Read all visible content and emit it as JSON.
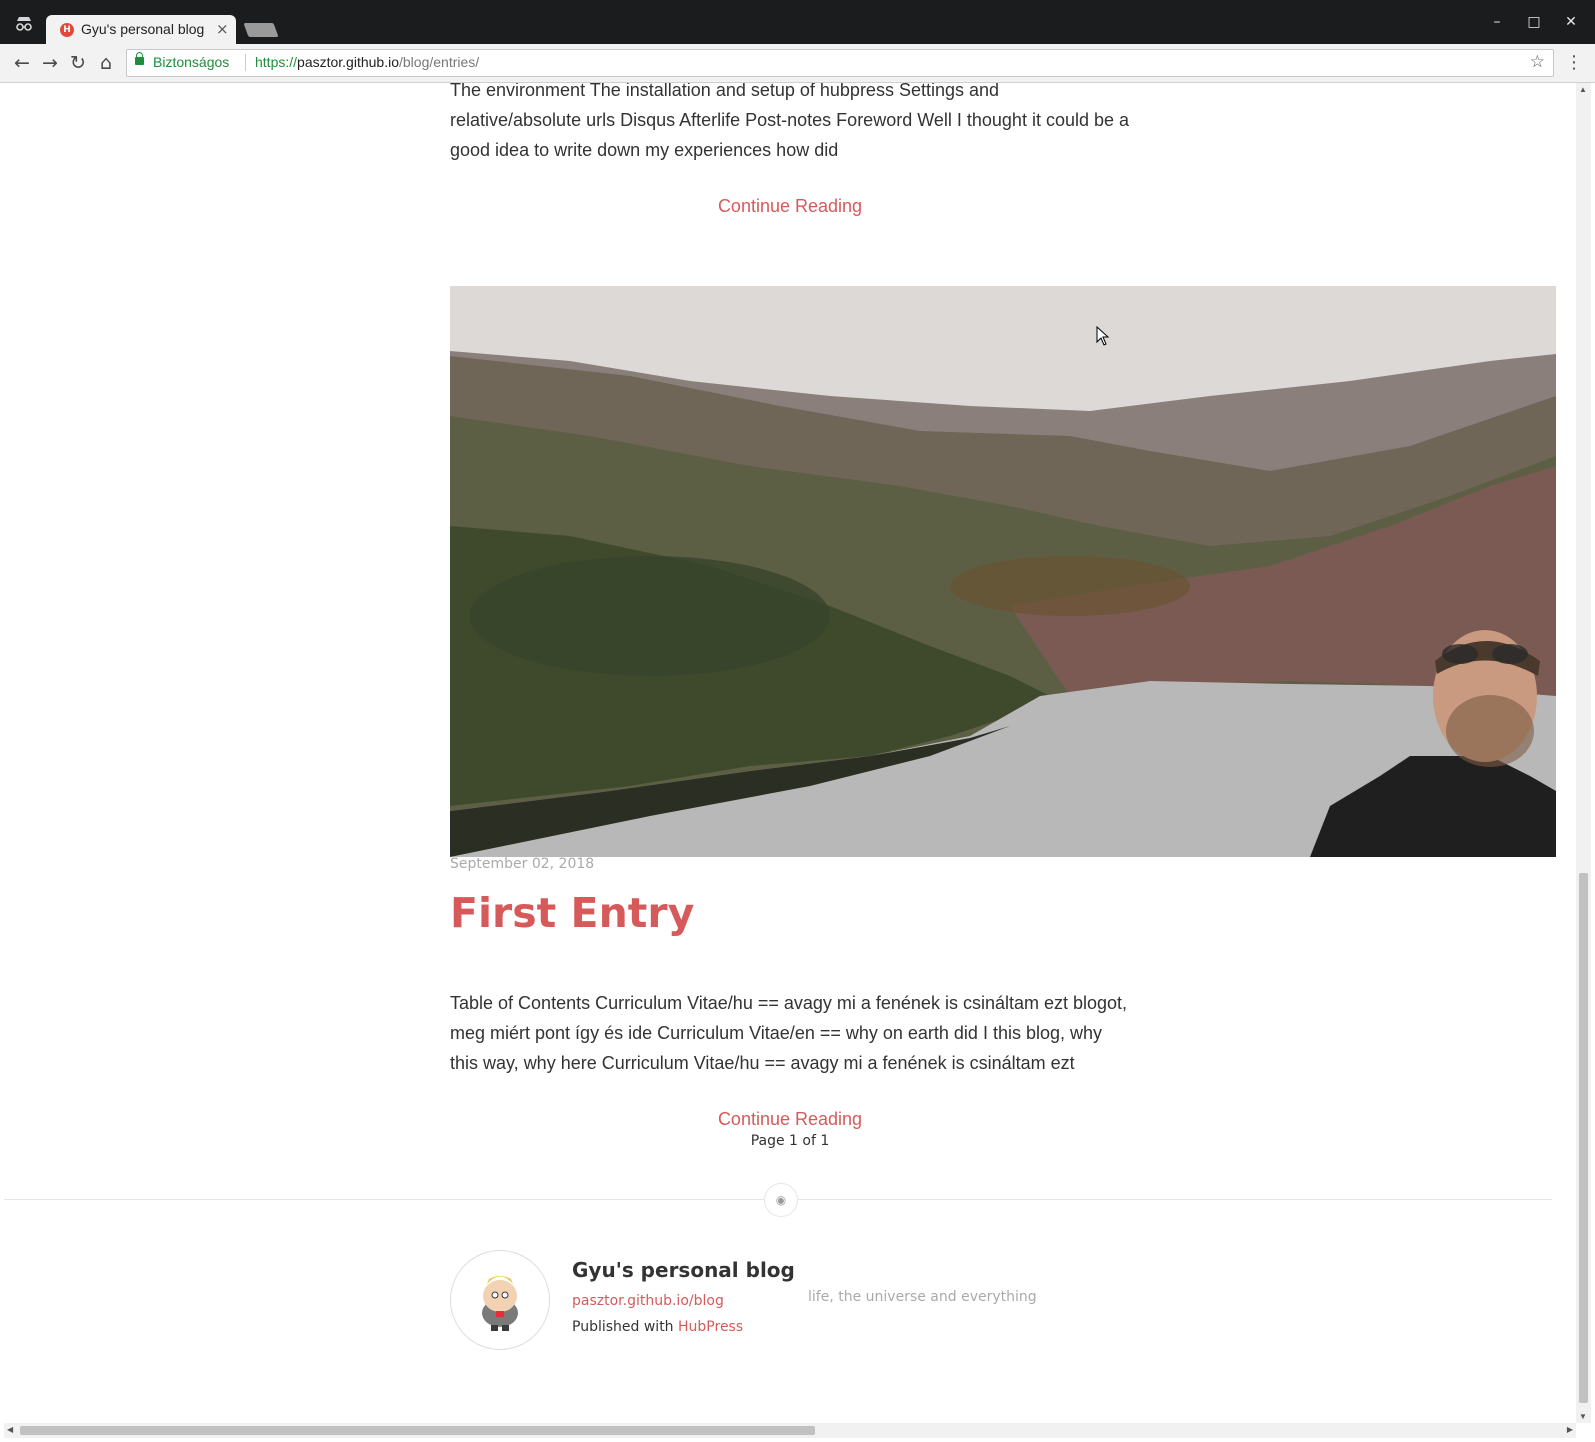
{
  "browser": {
    "tab_title": "Gyu's personal blog",
    "tab_favicon_letter": "H",
    "secure_label": "Biztonságos",
    "url": {
      "scheme": "https://",
      "host": "pasztor.github.io",
      "path": "/blog/entries/"
    }
  },
  "posts": [
    {
      "excerpt": "The environment The installation and setup of hubpress Settings and relative/absolute urls Disqus Afterlife Post-notes Foreword Well I thought it could be a good idea to write down my experiences how did",
      "continue_label": "Continue Reading"
    },
    {
      "date": "September 02, 2018",
      "title": "First Entry",
      "excerpt": "Table of Contents Curriculum Vitae/hu == avagy mi a fenének is csináltam ezt blogot, meg miért pont így és ide Curriculum Vitae/en == why on earth did I this blog, why this way, why here Curriculum Vitae/hu == avagy mi a fenének is csináltam ezt",
      "continue_label": "Continue Reading"
    }
  ],
  "pagination": "Page 1 of 1",
  "footer": {
    "blog_name": "Gyu's personal blog",
    "blog_url": "pasztor.github.io/blog",
    "published_prefix": "Published with",
    "published_link": "HubPress",
    "tagline": "life, the universe and everything"
  },
  "colors": {
    "accent": "#d65a5a",
    "secure": "#1e8e3e"
  }
}
